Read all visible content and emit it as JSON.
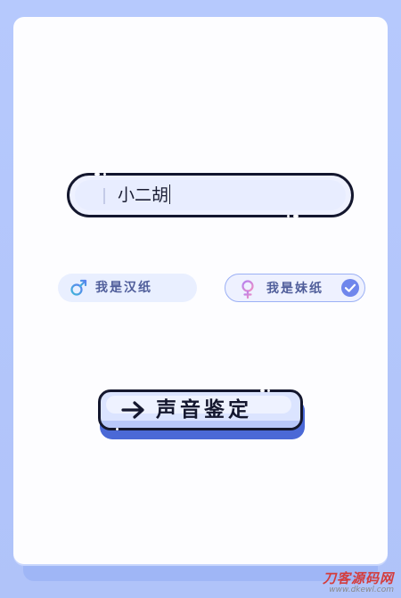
{
  "form": {
    "name_value": "小二胡"
  },
  "gender": {
    "options": [
      {
        "label": "我是汉纸",
        "icon": "male-symbol-icon",
        "selected": false
      },
      {
        "label": "我是妹纸",
        "icon": "female-symbol-icon",
        "selected": true
      }
    ]
  },
  "action": {
    "label": "声音鉴定",
    "icon": "arrow-right-icon"
  },
  "watermark": {
    "title": "刀客源码网",
    "url": "www.dkewl.com"
  },
  "colors": {
    "background": "#b3c7fb",
    "card": "#fdfdff",
    "outline": "#14172e",
    "accent": "#4b69d6",
    "male_icon": "#4fa3e6",
    "female_icon": "#d78be0",
    "label_text": "#4f5d9a"
  }
}
